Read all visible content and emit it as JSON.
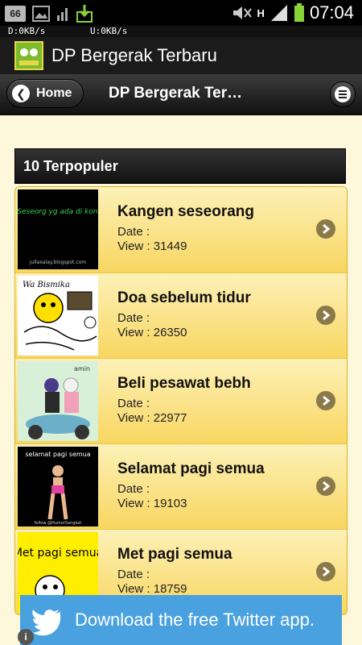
{
  "status_bar": {
    "badge": "66",
    "time": "07:04",
    "net_indicator": "H",
    "icons": [
      "notification-66-icon",
      "image-icon",
      "signal-bars-icon",
      "download-icon",
      "mute-icon",
      "signal-icon",
      "battery-icon"
    ]
  },
  "speed": {
    "down": "D:0KB/s",
    "up": "U:0KB/s"
  },
  "app": {
    "title": "DP Bergerak Terbaru"
  },
  "header": {
    "home_label": "Home",
    "title": "DP Bergerak Terbaru"
  },
  "section": {
    "title": "10 Terpopuler"
  },
  "items": [
    {
      "title": "Kangen seseorang",
      "date_label": "Date :",
      "view_label": "View : 31449",
      "thumb_caption": "Kangen Seseorg yg ada di kontak Bbm",
      "thumb_footer": "jullaxalay.blogspot.com"
    },
    {
      "title": "Doa sebelum tidur",
      "date_label": "Date :",
      "view_label": "View : 26350",
      "thumb_caption": "Wa Bismika"
    },
    {
      "title": "Beli pesawat bebh",
      "date_label": "Date :",
      "view_label": "View : 22977",
      "thumb_caption": "amin"
    },
    {
      "title": "Selamat pagi semua",
      "date_label": "Date :",
      "view_label": "View : 19103",
      "thumb_caption": "selamat pagi semua",
      "thumb_footer": "follow @HumorSangkat"
    },
    {
      "title": "Met pagi semua",
      "date_label": "Date :",
      "view_label": "View : 18759",
      "thumb_caption": "Met pagi semua"
    }
  ],
  "banner": {
    "text": "Download the free Twitter app."
  },
  "colors": {
    "accent": "#f8d660",
    "header": "#1b1b1b",
    "twitter": "#4aa1e0"
  }
}
